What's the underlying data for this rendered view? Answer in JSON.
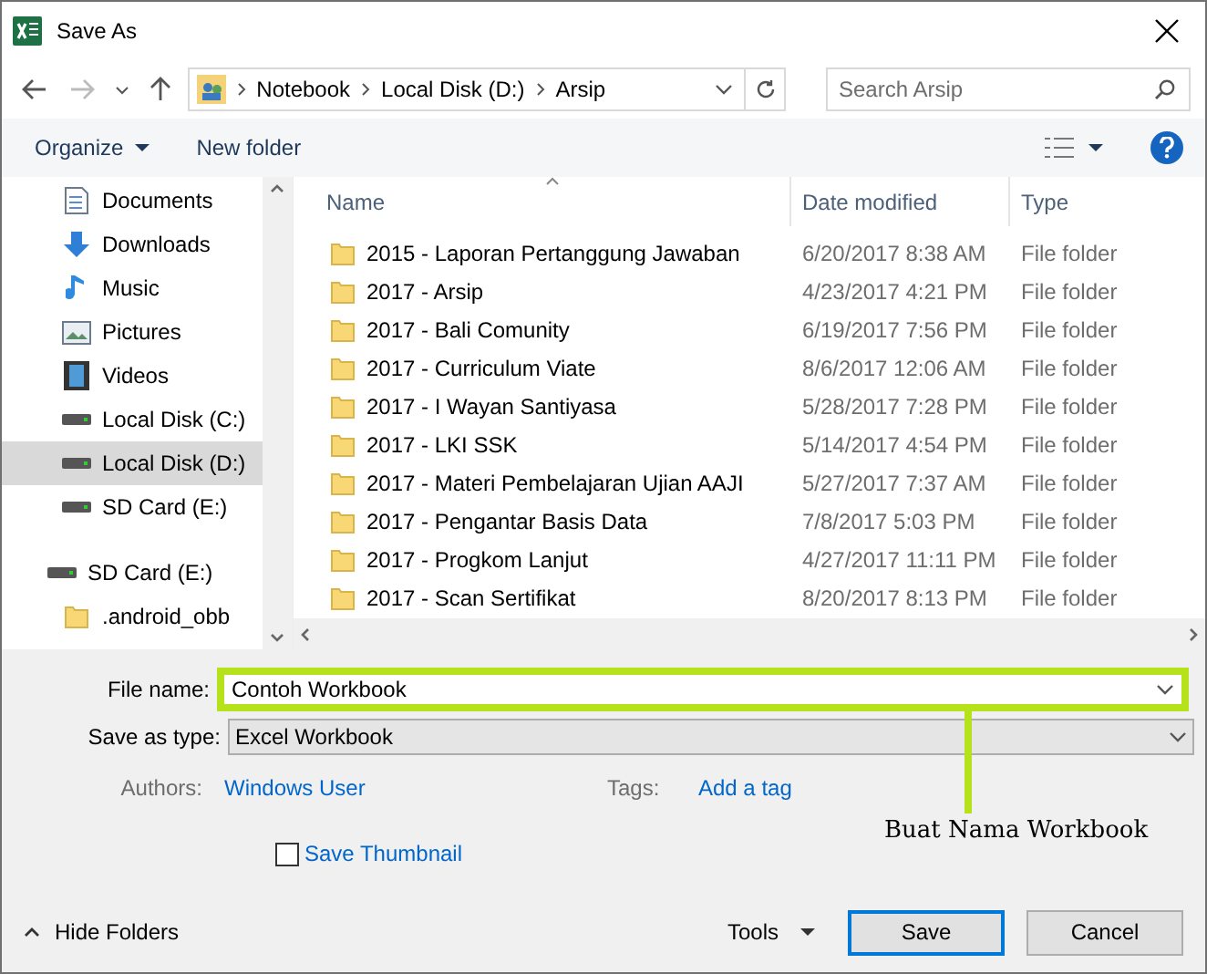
{
  "window": {
    "title": "Save As"
  },
  "address": {
    "path": [
      "Notebook",
      "Local Disk (D:)",
      "Arsip"
    ],
    "search_placeholder": "Search Arsip"
  },
  "toolbar": {
    "organize": "Organize",
    "new_folder": "New folder"
  },
  "sidebar": {
    "items": [
      {
        "label": "Documents",
        "kind": "documents",
        "selected": false
      },
      {
        "label": "Downloads",
        "kind": "downloads",
        "selected": false
      },
      {
        "label": "Music",
        "kind": "music",
        "selected": false
      },
      {
        "label": "Pictures",
        "kind": "pictures",
        "selected": false
      },
      {
        "label": "Videos",
        "kind": "videos",
        "selected": false
      },
      {
        "label": "Local Disk (C:)",
        "kind": "drive",
        "selected": false
      },
      {
        "label": "Local Disk (D:)",
        "kind": "drive",
        "selected": true
      },
      {
        "label": "SD Card (E:)",
        "kind": "drive",
        "selected": false
      },
      {
        "label": "SD Card (E:)",
        "kind": "root_drive",
        "selected": false
      },
      {
        "label": ".android_obb",
        "kind": "folder",
        "selected": false
      }
    ]
  },
  "table": {
    "columns": [
      "Name",
      "Date modified",
      "Type"
    ],
    "rows": [
      {
        "name": "2015 - Laporan Pertanggung Jawaban",
        "date": "6/20/2017 8:38 AM",
        "type": "File folder"
      },
      {
        "name": "2017 - Arsip",
        "date": "4/23/2017 4:21 PM",
        "type": "File folder"
      },
      {
        "name": "2017 - Bali Comunity",
        "date": "6/19/2017 7:56 PM",
        "type": "File folder"
      },
      {
        "name": "2017 - Curriculum Viate",
        "date": "8/6/2017 12:06 AM",
        "type": "File folder"
      },
      {
        "name": "2017 - I Wayan Santiyasa",
        "date": "5/28/2017 7:28 PM",
        "type": "File folder"
      },
      {
        "name": "2017 - LKI SSK",
        "date": "5/14/2017 4:54 PM",
        "type": "File folder"
      },
      {
        "name": "2017 - Materi Pembelajaran Ujian AAJI",
        "date": "5/27/2017 7:37 AM",
        "type": "File folder"
      },
      {
        "name": "2017 - Pengantar Basis Data",
        "date": "7/8/2017 5:03 PM",
        "type": "File folder"
      },
      {
        "name": "2017 - Progkom Lanjut",
        "date": "4/27/2017 11:11 PM",
        "type": "File folder"
      },
      {
        "name": "2017 - Scan Sertifikat",
        "date": "8/20/2017 8:13 PM",
        "type": "File folder"
      }
    ]
  },
  "form": {
    "file_name_label": "File name:",
    "file_name": "Contoh Workbook",
    "type_label": "Save as type:",
    "type": "Excel Workbook",
    "authors_label": "Authors:",
    "authors": "Windows User",
    "tags_label": "Tags:",
    "tags": "Add a tag",
    "thumbnail": {
      "label": "Save Thumbnail",
      "checked": false
    }
  },
  "footer": {
    "hide_folders": "Hide Folders",
    "tools": "Tools",
    "save": "Save",
    "cancel": "Cancel"
  },
  "annotation": {
    "text": "Buat Nama Workbook"
  }
}
